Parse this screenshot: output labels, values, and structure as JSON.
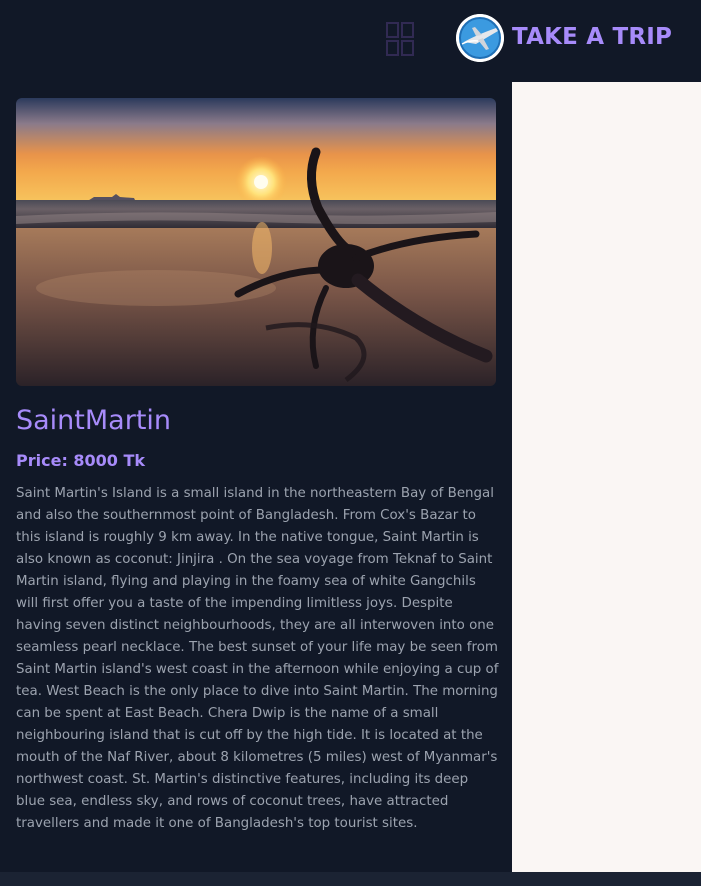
{
  "header": {
    "brand": "TAKE A TRIP",
    "menu_icon": "grid-menu-icon",
    "logo_icon": "airplane-globe-logo"
  },
  "place": {
    "name": "SaintMartin",
    "price_label": "Price: 8000 Tk",
    "image_alt": "sunset-anchor-beach-photo",
    "description": "Saint Martin's Island is a small island in the northeastern Bay of Bengal and also the southernmost point of Bangladesh. From Cox's Bazar to this island is roughly 9 km away. In the native tongue, Saint Martin is also known as coconut: Jinjira . On the sea voyage from Teknaf to Saint Martin island, flying and playing in the foamy sea of white Gangchils will first offer you a taste of the impending limitless joys. Despite having seven distinct neighbourhoods, they are all interwoven into one seamless pearl necklace. The best sunset of your life may be seen from Saint Martin island's west coast in the afternoon while enjoying a cup of tea. West Beach is the only place to dive into Saint Martin. The morning can be spent at East Beach. Chera Dwip is the name of a small neighbouring island that is cut off by the high tide. It is located at the mouth of the Naf River, about 8 kilometres (5 miles) west of Myanmar's northwest coast. St. Martin's distinctive features, including its deep blue sea, endless sky, and rows of coconut trees, have attracted travellers and made it one of Bangladesh's top tourist sites."
  },
  "colors": {
    "accent": "#a78bfa",
    "background": "#111827",
    "text": "#9ca3af",
    "panel": "#faf6f4"
  }
}
